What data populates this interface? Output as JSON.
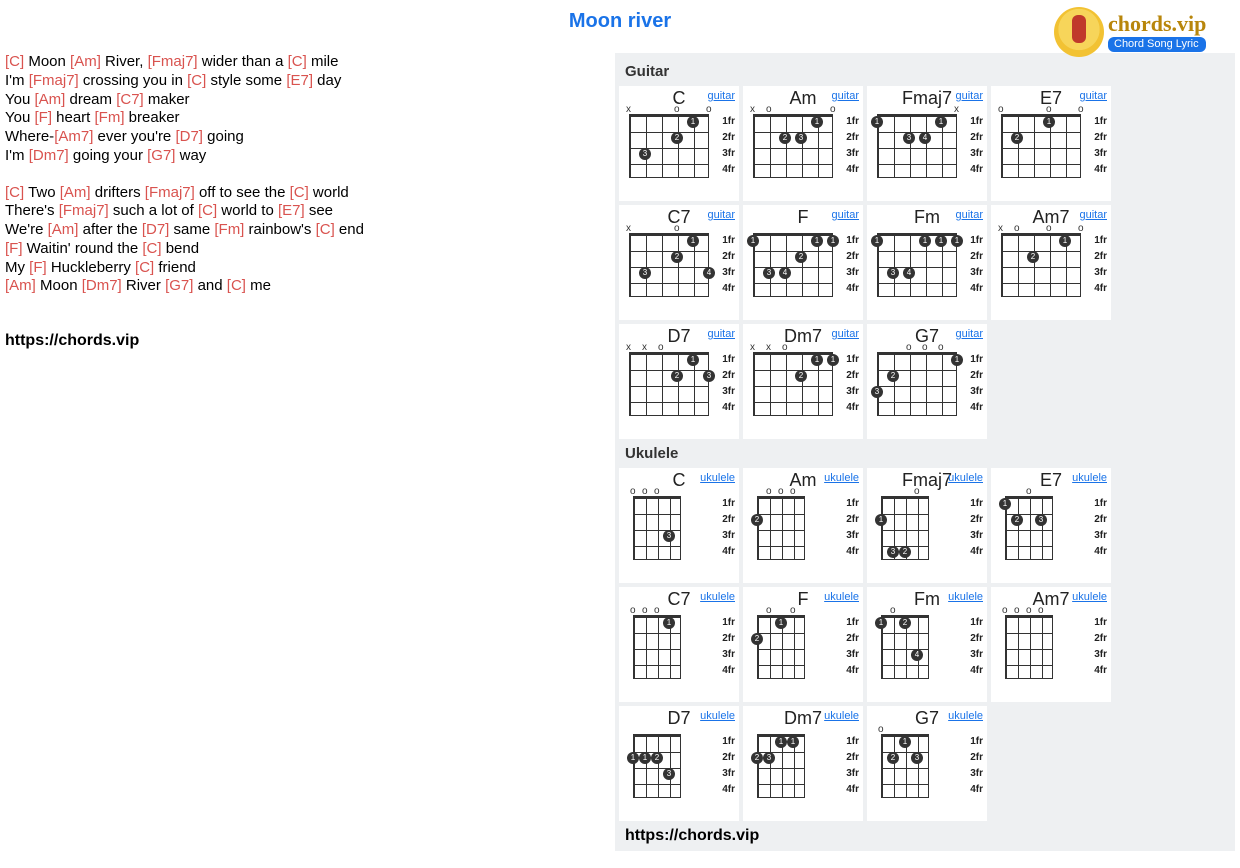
{
  "title": "Moon river",
  "logo": {
    "brand": "chords.vip",
    "tagline": "Chord Song Lyric"
  },
  "site_url": "https://chords.vip",
  "lyrics": [
    {
      "stanza": [
        [
          [
            "[C]",
            "chord"
          ],
          [
            " Moon ",
            ""
          ],
          [
            "[Am]",
            "chord"
          ],
          [
            " River, ",
            ""
          ],
          [
            "[Fmaj7]",
            "chord"
          ],
          [
            " wider than a ",
            ""
          ],
          [
            "[C]",
            "chord"
          ],
          [
            " mile",
            ""
          ]
        ],
        [
          [
            "I'm ",
            ""
          ],
          [
            "[Fmaj7]",
            "chord"
          ],
          [
            " crossing you in ",
            ""
          ],
          [
            "[C]",
            "chord"
          ],
          [
            " style some ",
            ""
          ],
          [
            "[E7]",
            "chord"
          ],
          [
            " day",
            ""
          ]
        ],
        [
          [
            "You ",
            ""
          ],
          [
            "[Am]",
            "chord"
          ],
          [
            " dream ",
            ""
          ],
          [
            "[C7]",
            "chord"
          ],
          [
            " maker",
            ""
          ]
        ],
        [
          [
            "You ",
            ""
          ],
          [
            "[F]",
            "chord"
          ],
          [
            " heart ",
            ""
          ],
          [
            "[Fm]",
            "chord"
          ],
          [
            " breaker",
            ""
          ]
        ],
        [
          [
            "Where-",
            ""
          ],
          [
            "[Am7]",
            "chord"
          ],
          [
            " ever you're ",
            ""
          ],
          [
            "[D7]",
            "chord"
          ],
          [
            " going",
            ""
          ]
        ],
        [
          [
            "I'm ",
            ""
          ],
          [
            "[Dm7]",
            "chord"
          ],
          [
            " going your ",
            ""
          ],
          [
            "[G7]",
            "chord"
          ],
          [
            " way",
            ""
          ]
        ]
      ]
    },
    {
      "stanza": [
        [
          [
            "[C]",
            "chord"
          ],
          [
            " Two ",
            ""
          ],
          [
            "[Am]",
            "chord"
          ],
          [
            " drifters ",
            ""
          ],
          [
            "[Fmaj7]",
            "chord"
          ],
          [
            " off to see the ",
            ""
          ],
          [
            "[C]",
            "chord"
          ],
          [
            " world",
            ""
          ]
        ],
        [
          [
            "There's ",
            ""
          ],
          [
            "[Fmaj7]",
            "chord"
          ],
          [
            " such a lot of ",
            ""
          ],
          [
            "[C]",
            "chord"
          ],
          [
            " world to ",
            ""
          ],
          [
            "[E7]",
            "chord"
          ],
          [
            " see",
            ""
          ]
        ],
        [
          [
            "We're ",
            ""
          ],
          [
            "[Am]",
            "chord"
          ],
          [
            " after the ",
            ""
          ],
          [
            "[D7]",
            "chord"
          ],
          [
            " same ",
            ""
          ],
          [
            "[Fm]",
            "chord"
          ],
          [
            " rainbow's ",
            ""
          ],
          [
            "[C]",
            "chord"
          ],
          [
            " end",
            ""
          ]
        ],
        [
          [
            "[F]",
            "chord"
          ],
          [
            " Waitin' round the ",
            ""
          ],
          [
            "[C]",
            "chord"
          ],
          [
            " bend",
            ""
          ]
        ],
        [
          [
            "My ",
            ""
          ],
          [
            "[F]",
            "chord"
          ],
          [
            " Huckleberry ",
            ""
          ],
          [
            "[C]",
            "chord"
          ],
          [
            " friend",
            ""
          ]
        ],
        [
          [
            "[Am]",
            "chord"
          ],
          [
            " Moon ",
            ""
          ],
          [
            "[Dm7]",
            "chord"
          ],
          [
            " River ",
            ""
          ],
          [
            "[G7]",
            "chord"
          ],
          [
            " and ",
            ""
          ],
          [
            "[C]",
            "chord"
          ],
          [
            " me",
            ""
          ]
        ]
      ]
    }
  ],
  "fret_labels": [
    "1fr",
    "2fr",
    "3fr",
    "4fr"
  ],
  "instruments": {
    "guitar": {
      "header": "Guitar",
      "label": "guitar",
      "strings": 6,
      "chords": [
        {
          "name": "C",
          "markers": [
            "x",
            "",
            "",
            "o",
            "",
            "o"
          ],
          "dots": [
            {
              "s": 4,
              "f": 1,
              "n": "1"
            },
            {
              "s": 3,
              "f": 2,
              "n": "2"
            },
            {
              "s": 1,
              "f": 3,
              "n": "3"
            }
          ]
        },
        {
          "name": "Am",
          "markers": [
            "x",
            "o",
            "",
            "",
            "",
            "o"
          ],
          "dots": [
            {
              "s": 4,
              "f": 1,
              "n": "1"
            },
            {
              "s": 2,
              "f": 2,
              "n": "2"
            },
            {
              "s": 3,
              "f": 2,
              "n": "3"
            }
          ]
        },
        {
          "name": "Fmaj7",
          "markers": [
            "",
            "",
            "",
            "",
            "",
            "x"
          ],
          "dots": [
            {
              "s": 0,
              "f": 1,
              "n": "1"
            },
            {
              "s": 4,
              "f": 1,
              "n": "1"
            },
            {
              "s": 2,
              "f": 2,
              "n": "3"
            },
            {
              "s": 3,
              "f": 2,
              "n": "4"
            }
          ]
        },
        {
          "name": "E7",
          "markers": [
            "o",
            "",
            "",
            "o",
            "",
            "o"
          ],
          "dots": [
            {
              "s": 3,
              "f": 1,
              "n": "1"
            },
            {
              "s": 1,
              "f": 2,
              "n": "2"
            }
          ]
        },
        {
          "name": "C7",
          "markers": [
            "x",
            "",
            "",
            "o",
            "",
            ""
          ],
          "dots": [
            {
              "s": 4,
              "f": 1,
              "n": "1"
            },
            {
              "s": 3,
              "f": 2,
              "n": "2"
            },
            {
              "s": 1,
              "f": 3,
              "n": "3"
            },
            {
              "s": 5,
              "f": 3,
              "n": "4"
            }
          ]
        },
        {
          "name": "F",
          "markers": [
            "",
            "",
            "",
            "",
            "",
            ""
          ],
          "dots": [
            {
              "s": 0,
              "f": 1,
              "n": "1"
            },
            {
              "s": 4,
              "f": 1,
              "n": "1"
            },
            {
              "s": 5,
              "f": 1,
              "n": "1"
            },
            {
              "s": 3,
              "f": 2,
              "n": "2"
            },
            {
              "s": 1,
              "f": 3,
              "n": "3"
            },
            {
              "s": 2,
              "f": 3,
              "n": "4"
            }
          ]
        },
        {
          "name": "Fm",
          "markers": [
            "",
            "",
            "",
            "",
            "",
            ""
          ],
          "dots": [
            {
              "s": 0,
              "f": 1,
              "n": "1"
            },
            {
              "s": 3,
              "f": 1,
              "n": "1"
            },
            {
              "s": 4,
              "f": 1,
              "n": "1"
            },
            {
              "s": 5,
              "f": 1,
              "n": "1"
            },
            {
              "s": 1,
              "f": 3,
              "n": "3"
            },
            {
              "s": 2,
              "f": 3,
              "n": "4"
            }
          ]
        },
        {
          "name": "Am7",
          "markers": [
            "x",
            "o",
            "",
            "o",
            "",
            "o"
          ],
          "dots": [
            {
              "s": 4,
              "f": 1,
              "n": "1"
            },
            {
              "s": 2,
              "f": 2,
              "n": "2"
            }
          ]
        },
        {
          "name": "D7",
          "markers": [
            "x",
            "x",
            "o",
            "",
            "",
            ""
          ],
          "dots": [
            {
              "s": 4,
              "f": 1,
              "n": "1"
            },
            {
              "s": 3,
              "f": 2,
              "n": "2"
            },
            {
              "s": 5,
              "f": 2,
              "n": "3"
            }
          ]
        },
        {
          "name": "Dm7",
          "markers": [
            "x",
            "x",
            "o",
            "",
            "",
            ""
          ],
          "dots": [
            {
              "s": 4,
              "f": 1,
              "n": "1"
            },
            {
              "s": 5,
              "f": 1,
              "n": "1"
            },
            {
              "s": 3,
              "f": 2,
              "n": "2"
            }
          ]
        },
        {
          "name": "G7",
          "markers": [
            "",
            "",
            "o",
            "o",
            "o",
            ""
          ],
          "dots": [
            {
              "s": 5,
              "f": 1,
              "n": "1"
            },
            {
              "s": 1,
              "f": 2,
              "n": "2"
            },
            {
              "s": 0,
              "f": 3,
              "n": "3"
            }
          ]
        }
      ]
    },
    "ukulele": {
      "header": "Ukulele",
      "label": "ukulele",
      "strings": 4,
      "chords": [
        {
          "name": "C",
          "markers": [
            "o",
            "o",
            "o",
            ""
          ],
          "dots": [
            {
              "s": 3,
              "f": 3,
              "n": "3"
            }
          ]
        },
        {
          "name": "Am",
          "markers": [
            "",
            "o",
            "o",
            "o"
          ],
          "dots": [
            {
              "s": 0,
              "f": 2,
              "n": "2"
            }
          ]
        },
        {
          "name": "Fmaj7",
          "markers": [
            "",
            "",
            "",
            "o"
          ],
          "dots": [
            {
              "s": 0,
              "f": 2,
              "n": "1"
            },
            {
              "s": 2,
              "f": 4,
              "n": "2"
            },
            {
              "s": 1,
              "f": 4,
              "n": "3"
            }
          ]
        },
        {
          "name": "E7",
          "markers": [
            "",
            "",
            "o",
            ""
          ],
          "dots": [
            {
              "s": 0,
              "f": 1,
              "n": "1"
            },
            {
              "s": 1,
              "f": 2,
              "n": "2"
            },
            {
              "s": 3,
              "f": 2,
              "n": "3"
            }
          ]
        },
        {
          "name": "C7",
          "markers": [
            "o",
            "o",
            "o",
            ""
          ],
          "dots": [
            {
              "s": 3,
              "f": 1,
              "n": "1"
            }
          ]
        },
        {
          "name": "F",
          "markers": [
            "",
            "o",
            "",
            "o"
          ],
          "dots": [
            {
              "s": 2,
              "f": 1,
              "n": "1"
            },
            {
              "s": 0,
              "f": 2,
              "n": "2"
            }
          ]
        },
        {
          "name": "Fm",
          "markers": [
            "",
            "o",
            "",
            ""
          ],
          "dots": [
            {
              "s": 0,
              "f": 1,
              "n": "1"
            },
            {
              "s": 2,
              "f": 1,
              "n": "2"
            },
            {
              "s": 3,
              "f": 3,
              "n": "4"
            }
          ]
        },
        {
          "name": "Am7",
          "markers": [
            "o",
            "o",
            "o",
            "o"
          ],
          "dots": []
        },
        {
          "name": "D7",
          "markers": [
            "",
            "",
            "",
            ""
          ],
          "dots": [
            {
              "s": 0,
              "f": 2,
              "n": "1"
            },
            {
              "s": 2,
              "f": 2,
              "n": "2"
            },
            {
              "s": 3,
              "f": 3,
              "n": "3"
            },
            {
              "s": 1,
              "f": 2,
              "n": "1"
            }
          ]
        },
        {
          "name": "Dm7",
          "markers": [
            "",
            "",
            "",
            ""
          ],
          "dots": [
            {
              "s": 2,
              "f": 1,
              "n": "1"
            },
            {
              "s": 3,
              "f": 1,
              "n": "1"
            },
            {
              "s": 0,
              "f": 2,
              "n": "2"
            },
            {
              "s": 1,
              "f": 2,
              "n": "3"
            }
          ]
        },
        {
          "name": "G7",
          "markers": [
            "o",
            "",
            "",
            ""
          ],
          "dots": [
            {
              "s": 2,
              "f": 1,
              "n": "1"
            },
            {
              "s": 1,
              "f": 2,
              "n": "2"
            },
            {
              "s": 3,
              "f": 2,
              "n": "3"
            }
          ]
        }
      ]
    }
  }
}
